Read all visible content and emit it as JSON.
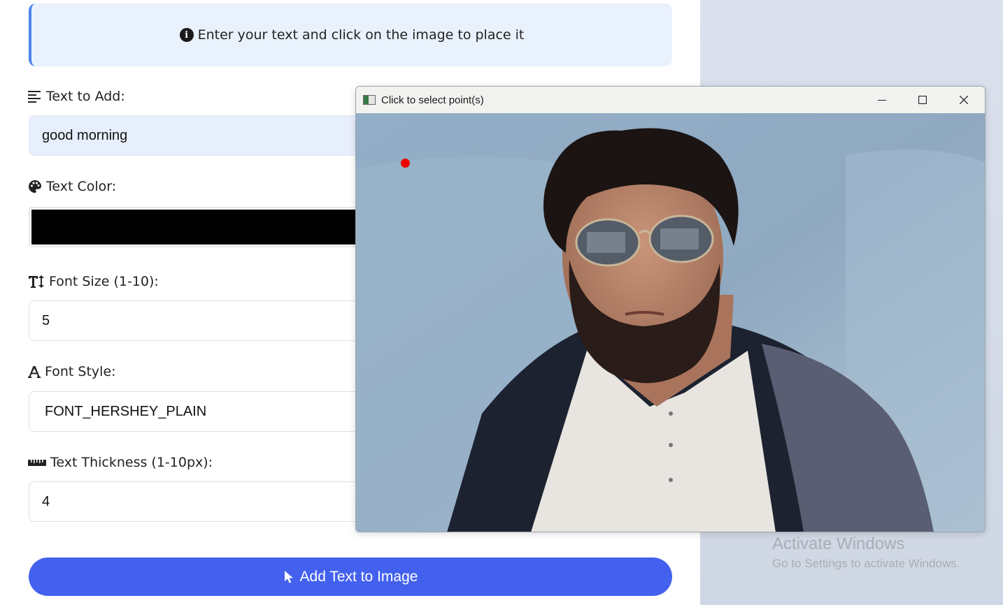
{
  "info": {
    "text": "Enter your text and click on the image to place it",
    "icon": "info-circle-icon"
  },
  "fields": {
    "text": {
      "label": "Text to Add:",
      "value": "good morning",
      "icon": "align-left-icon"
    },
    "color": {
      "label": "Text Color:",
      "value": "#000000",
      "icon": "palette-icon"
    },
    "font_size": {
      "label": "Font Size (1-10):",
      "value": "5",
      "icon": "text-height-icon"
    },
    "font_style": {
      "label": "Font Style:",
      "value": "FONT_HERSHEY_PLAIN",
      "icon": "font-icon"
    },
    "thickness": {
      "label": "Text Thickness (1-10px):",
      "value": "4",
      "icon": "ruler-icon"
    }
  },
  "add_button": {
    "label": "Add Text to Image",
    "icon": "pointer-icon"
  },
  "cv_window": {
    "title": "Click to select point(s)",
    "selected_point_color": "#ee0000"
  },
  "watermark": {
    "title": "Activate Windows",
    "subtitle": "Go to Settings to activate Windows."
  },
  "colors": {
    "accent": "#4361ee",
    "info_border": "#4a86e8",
    "info_bg": "#e9f1fd"
  }
}
